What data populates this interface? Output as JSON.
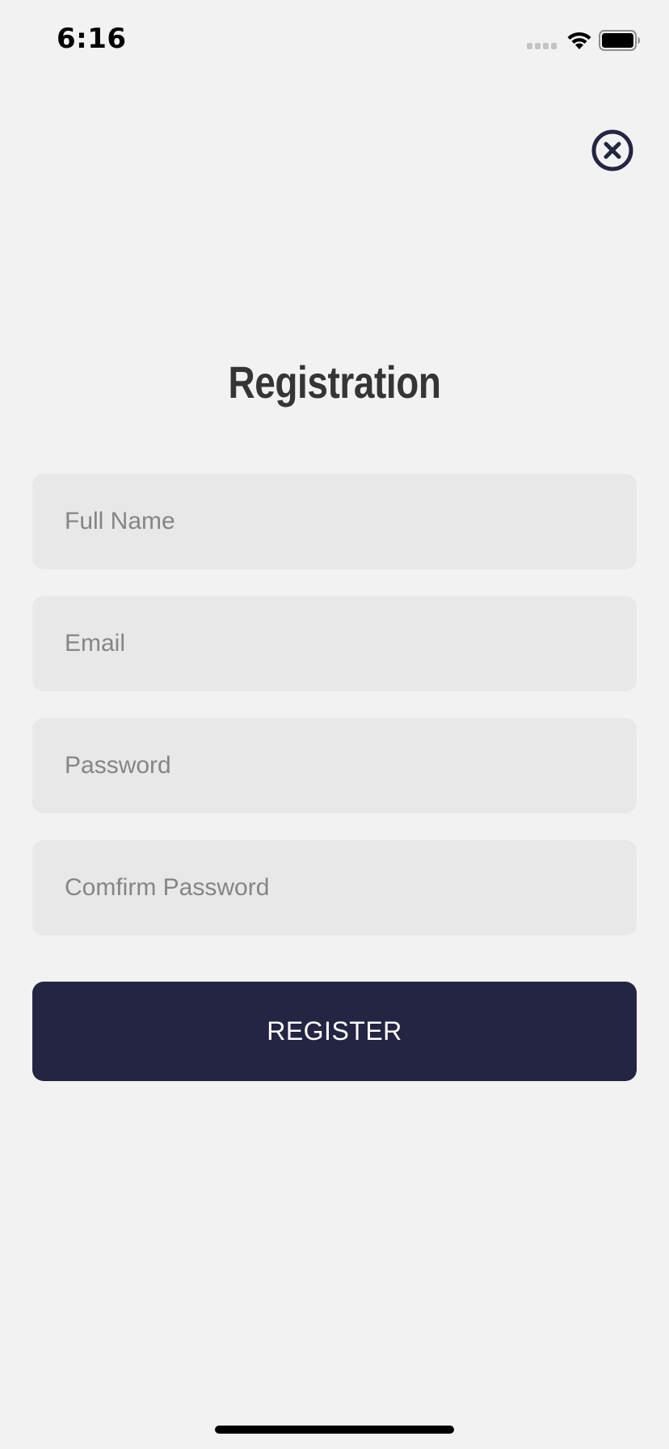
{
  "status_bar": {
    "time": "6:16"
  },
  "title": "Registration",
  "form": {
    "full_name_placeholder": "Full Name",
    "email_placeholder": "Email",
    "password_placeholder": "Password",
    "confirm_password_placeholder": "Comfirm Password",
    "register_label": "REGISTER"
  },
  "icons": {
    "close": "close-circle-icon",
    "signal": "cellular-signal-icon",
    "wifi": "wifi-icon",
    "battery": "battery-icon"
  },
  "colors": {
    "background": "#f2f2f2",
    "field_background": "#e8e8e8",
    "accent": "#242543",
    "title": "#353535",
    "placeholder": "#858585"
  }
}
